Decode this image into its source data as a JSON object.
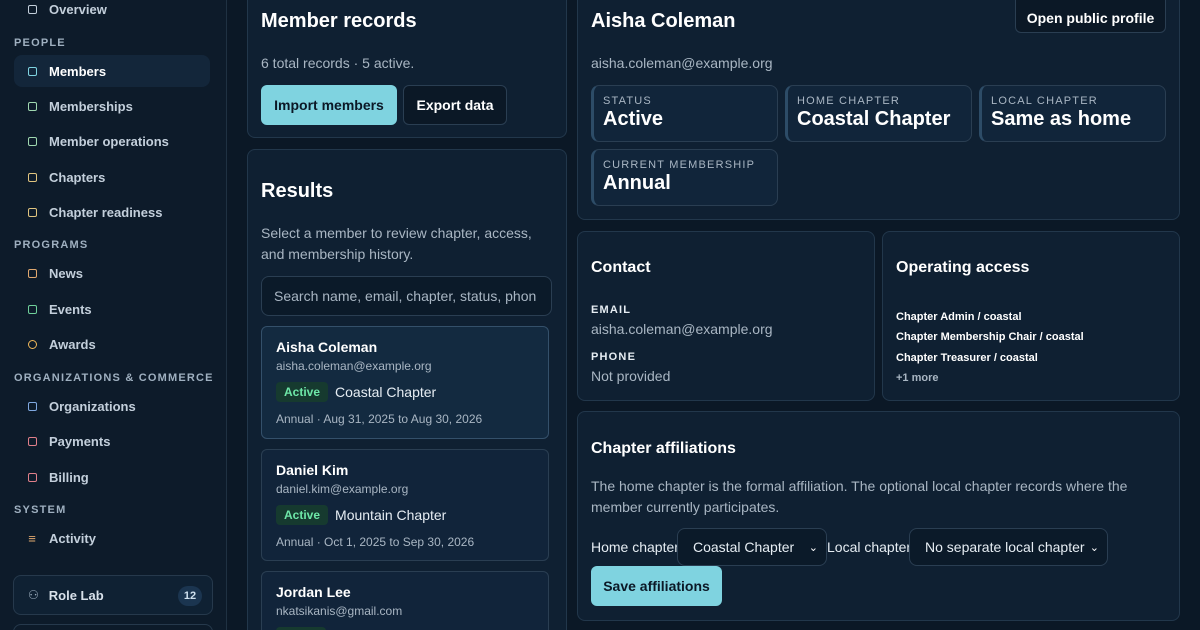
{
  "sidebar": {
    "top_item": "Overview",
    "sections": {
      "people": "PEOPLE",
      "programs": "PROGRAMS",
      "orgs": "ORGANIZATIONS & COMMERCE",
      "system": "SYSTEM"
    },
    "items": {
      "members": "Members",
      "memberships": "Memberships",
      "member_operations": "Member operations",
      "chapters": "Chapters",
      "chapter_readiness": "Chapter readiness",
      "news": "News",
      "events": "Events",
      "awards": "Awards",
      "organizations": "Organizations",
      "payments": "Payments",
      "billing": "Billing",
      "activity": "Activity"
    },
    "role_lab": {
      "label": "Role Lab",
      "count": "12"
    }
  },
  "records": {
    "title": "Member records",
    "summary": "6 total records · 5 active.",
    "import_label": "Import members",
    "export_label": "Export data"
  },
  "results": {
    "title": "Results",
    "description": "Select a member to review chapter, access, and membership history.",
    "search_placeholder": "Search name, email, chapter, status, phon",
    "members": [
      {
        "name": "Aisha Coleman",
        "email": "aisha.coleman@example.org",
        "status": "Active",
        "chapter": "Coastal Chapter",
        "term": "Annual · Aug 31, 2025 to Aug 30, 2026"
      },
      {
        "name": "Daniel Kim",
        "email": "daniel.kim@example.org",
        "status": "Active",
        "chapter": "Mountain Chapter",
        "term": "Annual · Oct 1, 2025 to Sep 30, 2026"
      },
      {
        "name": "Jordan Lee",
        "email": "nkatsikanis@gmail.com"
      }
    ]
  },
  "detail": {
    "name": "Aisha Coleman",
    "email": "aisha.coleman@example.org",
    "open_profile_label": "Open public profile",
    "stats": {
      "status": {
        "label": "STATUS",
        "value": "Active"
      },
      "home": {
        "label": "HOME CHAPTER",
        "value": "Coastal Chapter"
      },
      "local": {
        "label": "LOCAL CHAPTER",
        "value": "Same as home"
      },
      "membership": {
        "label": "CURRENT MEMBERSHIP",
        "value": "Annual"
      }
    }
  },
  "contact": {
    "title": "Contact",
    "email_label": "EMAIL",
    "email_value": "aisha.coleman@example.org",
    "phone_label": "PHONE",
    "phone_value": "Not provided"
  },
  "access": {
    "title": "Operating access",
    "roles": [
      "Chapter Admin / coastal",
      "Chapter Membership Chair / coastal",
      "Chapter Treasurer / coastal"
    ],
    "more": "+1 more"
  },
  "affiliations": {
    "title": "Chapter affiliations",
    "description": "The home chapter is the formal affiliation. The optional local chapter records where the member currently participates.",
    "home_label": "Home chapter",
    "home_value": "Coastal Chapter",
    "local_label": "Local chapter",
    "local_value": "No separate local chapter",
    "save_label": "Save affiliations"
  },
  "colors": {
    "background": "#0b1826",
    "panel": "#0f2032",
    "accent": "#7fd3e0",
    "active_badge": "#6ee7a8"
  }
}
